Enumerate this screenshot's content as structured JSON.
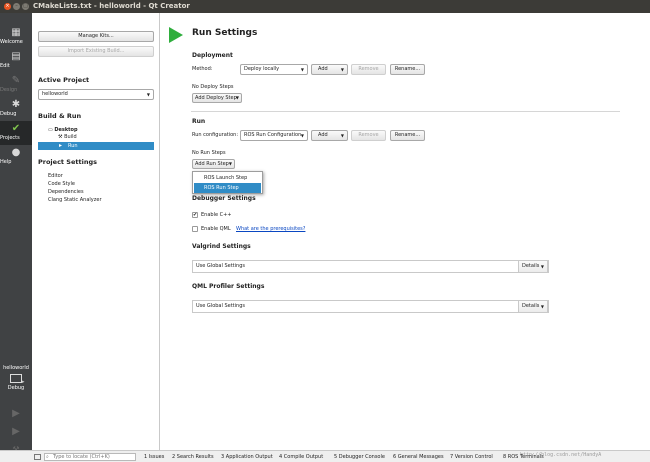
{
  "window": {
    "title": "CMakeLists.txt - helloworld - Qt Creator"
  },
  "modes": [
    {
      "label": "Welcome",
      "icon": "grid-icon"
    },
    {
      "label": "Edit",
      "icon": "document-icon"
    },
    {
      "label": "Design",
      "icon": "pencil-icon"
    },
    {
      "label": "Debug",
      "icon": "bug-icon"
    },
    {
      "label": "Projects",
      "icon": "wrench-icon"
    },
    {
      "label": "Help",
      "icon": "help-icon"
    }
  ],
  "kit_selector": {
    "project": "helloworld",
    "config": "Debug"
  },
  "left": {
    "manage_kits": "Manage Kits...",
    "import_build": "Import Existing Build...",
    "active_project_title": "Active Project",
    "active_project_value": "helloworld",
    "build_run_title": "Build & Run",
    "tree": {
      "desktop": "Desktop",
      "build": "Build",
      "run": "Run"
    },
    "project_settings_title": "Project Settings",
    "settings_items": [
      "Editor",
      "Code Style",
      "Dependencies",
      "Clang Static Analyzer"
    ]
  },
  "main": {
    "title": "Run Settings",
    "deployment": {
      "title": "Deployment",
      "method_label": "Method:",
      "method_value": "Deploy locally",
      "add": "Add",
      "remove": "Remove",
      "rename": "Rename...",
      "no_steps": "No Deploy Steps",
      "add_step": "Add Deploy Step"
    },
    "run": {
      "title": "Run",
      "config_label": "Run configuration:",
      "config_value": "ROS Run Configuration",
      "add": "Add",
      "remove": "Remove",
      "rename": "Rename...",
      "no_steps": "No Run Steps",
      "add_step": "Add Run Step"
    },
    "popup_items": [
      "ROS Launch Step",
      "ROS Run Step"
    ],
    "debugger": {
      "title": "Debugger Settings",
      "enable_cpp": "Enable C++",
      "enable_cpp_checked": true,
      "enable_qml": "Enable QML",
      "enable_qml_checked": false,
      "prereq_link": "What are the prerequisites?"
    },
    "valgrind": {
      "title": "Valgrind Settings",
      "value": "Use Global Settings",
      "details": "Details"
    },
    "qml_profiler": {
      "title": "QML Profiler Settings",
      "value": "Use Global Settings",
      "details": "Details"
    }
  },
  "statusbar": {
    "locator_placeholder": "Type to locate (Ctrl+K)",
    "tabs": [
      "1 Issues",
      "2 Search Results",
      "3 Application Output",
      "4 Compile Output",
      "5 Debugger Console",
      "6 General Messages",
      "7 Version Control",
      "8 ROS Terminals"
    ]
  },
  "watermark": "http://blog.csdn.net/HandyA"
}
